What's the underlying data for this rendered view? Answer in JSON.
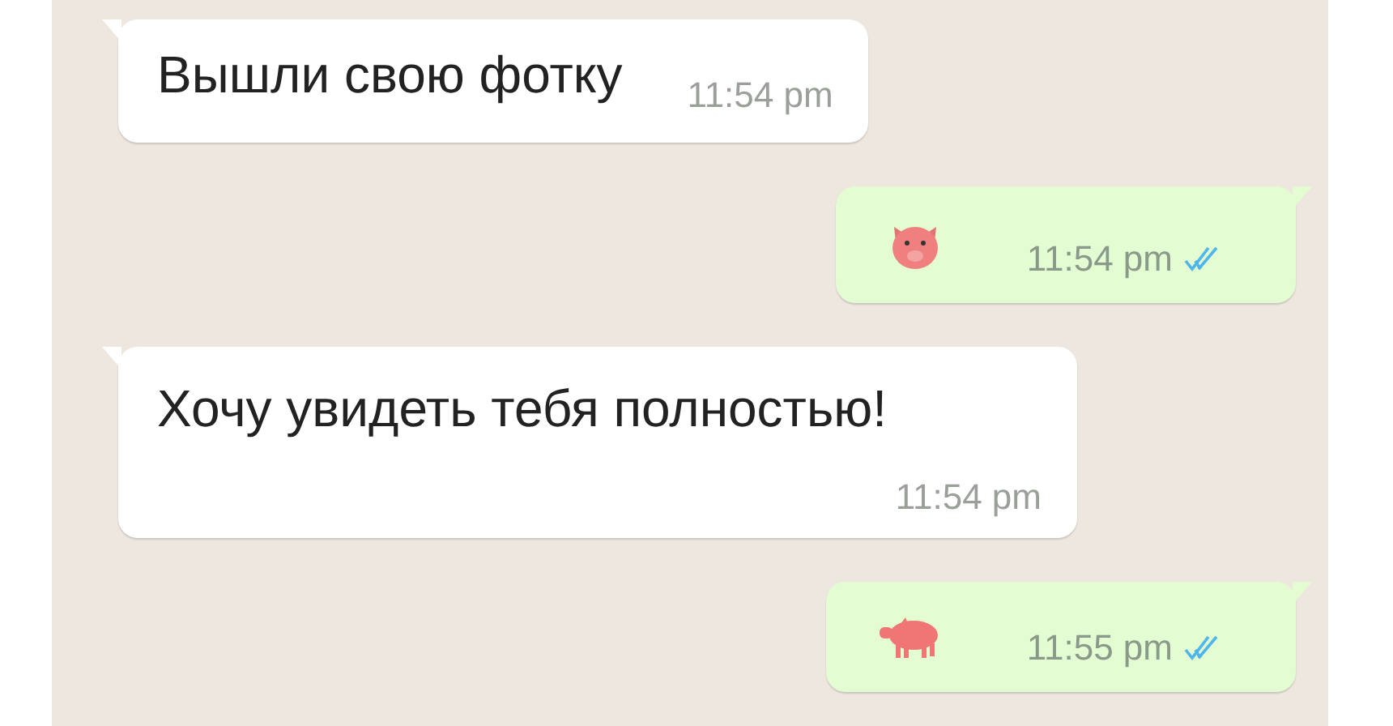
{
  "messages": [
    {
      "outgoing": false,
      "kind": "text",
      "text": "Вышли свою фотку",
      "time": "11:54 pm",
      "time_below": false
    },
    {
      "outgoing": true,
      "kind": "pig-face",
      "time": "11:54 pm",
      "read": true
    },
    {
      "outgoing": false,
      "kind": "text",
      "text": "Хочу увидеть тебя полностью!",
      "time": "11:54 pm",
      "time_below": true
    },
    {
      "outgoing": true,
      "kind": "pig",
      "time": "11:55 pm",
      "read": true
    }
  ]
}
